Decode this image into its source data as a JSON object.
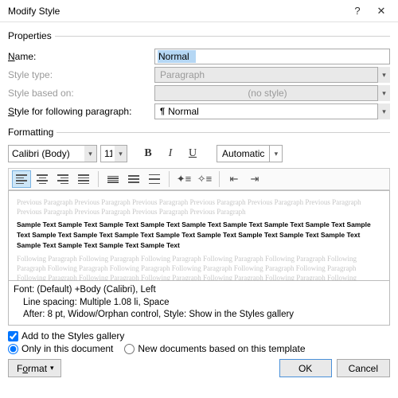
{
  "window": {
    "title": "Modify Style"
  },
  "properties": {
    "legend": "Properties",
    "name_label_pre": "",
    "name_label_u": "N",
    "name_label_post": "ame:",
    "name_value": "Normal",
    "type_label": "Style type:",
    "type_value": "Paragraph",
    "based_label": "Style based on:",
    "based_value": "(no style)",
    "follow_label_pre": "",
    "follow_label_u": "S",
    "follow_label_post": "tyle for following paragraph:",
    "follow_value": "Normal"
  },
  "formatting": {
    "legend": "Formatting",
    "font": "Calibri (Body)",
    "size": "11",
    "color_label": "Automatic"
  },
  "preview": {
    "ghost_line": "Previous Paragraph Previous Paragraph Previous Paragraph Previous Paragraph Previous Paragraph Previous Paragraph Previous Paragraph Previous Paragraph Previous Paragraph Previous Paragraph",
    "sample": "Sample Text Sample Text Sample Text Sample Text Sample Text Sample Text Sample Text Sample Text Sample Text Sample Text Sample Text Sample Text Sample Text Sample Text Sample Text Sample Text Sample Text Sample Text Sample Text Sample Text Sample Text",
    "ghost_after": "Following Paragraph Following Paragraph Following Paragraph Following Paragraph Following Paragraph Following Paragraph Following Paragraph Following Paragraph Following Paragraph Following Paragraph Following Paragraph Following Paragraph Following Paragraph Following Paragraph Following Paragraph Following Paragraph Following Paragraph Following Paragraph Following Paragraph"
  },
  "description": {
    "line1": "Font: (Default) +Body (Calibri), Left",
    "line2": "Line spacing:  Multiple 1.08 li, Space",
    "line3": "After:  8 pt, Widow/Orphan control, Style: Show in the Styles gallery"
  },
  "options": {
    "add_gallery": "Add to the Styles gallery",
    "only_doc": "Only in this document",
    "new_docs": "New documents based on this template"
  },
  "footer": {
    "format": "Format",
    "ok": "OK",
    "cancel": "Cancel"
  }
}
